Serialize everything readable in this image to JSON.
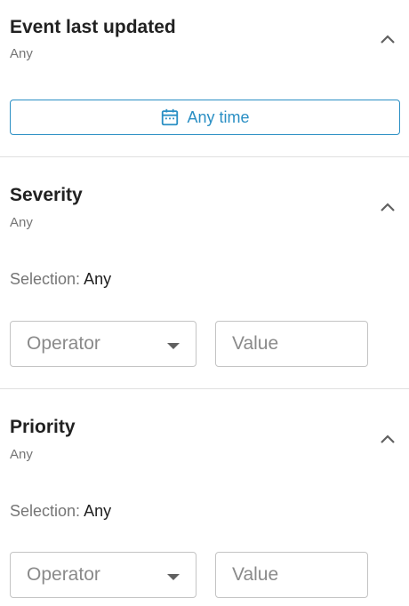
{
  "sections": [
    {
      "title": "Event last updated",
      "subtitle": "Any",
      "time_button_label": "Any time"
    },
    {
      "title": "Severity",
      "subtitle": "Any",
      "selection_label": "Selection:",
      "selection_value": "Any",
      "operator_placeholder": "Operator",
      "value_placeholder": "Value"
    },
    {
      "title": "Priority",
      "subtitle": "Any",
      "selection_label": "Selection:",
      "selection_value": "Any",
      "operator_placeholder": "Operator",
      "value_placeholder": "Value"
    }
  ],
  "icons": {
    "collapse": "chevron-up-icon",
    "calendar": "calendar-icon",
    "dropdown": "caret-down-icon"
  },
  "colors": {
    "accent": "#2a8fc4",
    "divider": "#e0e0e0",
    "field_border": "#c4c4c4"
  }
}
